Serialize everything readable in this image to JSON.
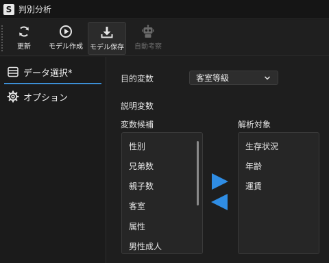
{
  "window": {
    "logo_letter": "S",
    "title": "判別分析"
  },
  "toolbar": {
    "update": {
      "label": "更新",
      "icon": "refresh-icon"
    },
    "create_model": {
      "label": "モデル作成",
      "icon": "play-circle-icon"
    },
    "save_model": {
      "label": "モデル保存",
      "icon": "download-icon"
    },
    "auto_consider": {
      "label": "自動考察",
      "icon": "robot-icon"
    }
  },
  "sidebar": {
    "items": [
      {
        "label": "データ選択*",
        "icon": "table-icon"
      },
      {
        "label": "オプション",
        "icon": "gear-icon"
      }
    ]
  },
  "main": {
    "target_label": "目的変数",
    "target_value": "客室等級",
    "explanatory_label": "説明変数",
    "candidates_label": "変数候補",
    "targets_label": "解析対象",
    "candidates": [
      "性別",
      "兄弟数",
      "親子数",
      "客室",
      "属性",
      "男性成人"
    ],
    "selected": [
      "生存状況",
      "年齢",
      "運賃"
    ]
  },
  "colors": {
    "accent": "#3c8fd6",
    "arrow": "#2f8de4"
  }
}
